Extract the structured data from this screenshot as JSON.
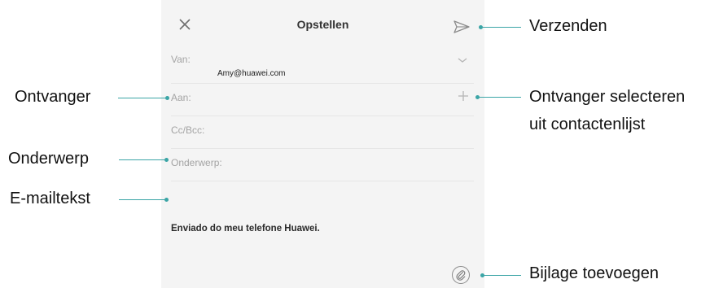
{
  "email_compose": {
    "title": "Opstellen",
    "fields": {
      "from_label": "Van:",
      "from_value": "Amy@huawei.com",
      "to_label": "Aan:",
      "cc_bcc_label": "Cc/Bcc:",
      "subject_label": "Onderwerp:"
    },
    "body_signature": "Enviado do meu telefone Huawei.",
    "icons": {
      "close": "close-icon",
      "send": "send-icon",
      "from_dropdown": "chevron-down-icon",
      "add_recipient": "plus-icon",
      "attachment": "paperclip-icon"
    }
  },
  "callouts": {
    "send": "Verzenden",
    "recipient": "Ontvanger",
    "select_recipient_line1": "Ontvanger selecteren",
    "select_recipient_line2": "uit contactenlijst",
    "subject": "Onderwerp",
    "email_body": "E-mailtekst",
    "add_attachment": "Bijlage toevoegen"
  },
  "colors": {
    "callout_line": "#3ba5a6",
    "screen_background": "#f4f4f4"
  }
}
